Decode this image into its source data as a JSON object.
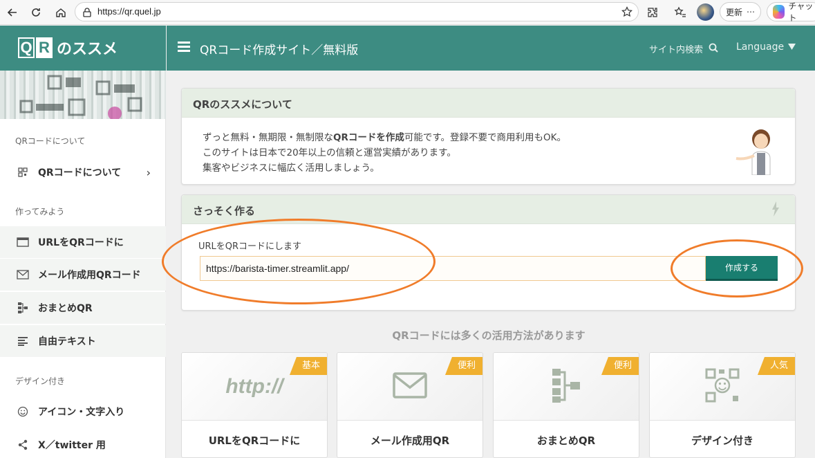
{
  "browser": {
    "url": "https://qr.quel.jp",
    "update_label": "更新",
    "more_label": "⋯",
    "chat_label": "チャット"
  },
  "header": {
    "logo_q": "Q",
    "logo_r": "R",
    "logo_suffix": "のススメ",
    "title": "QRコード作成サイト／無料版",
    "site_search": "サイト内検索",
    "language": "Language"
  },
  "sidebar": {
    "section_about": "QRコードについて",
    "item_about": "QRコードについて",
    "section_make": "作ってみよう",
    "items_make": [
      {
        "label": "URLをQRコードに"
      },
      {
        "label": "メール作成用QRコード"
      },
      {
        "label": "おまとめQR"
      },
      {
        "label": "自由テキスト"
      }
    ],
    "section_design": "デザイン付き",
    "items_design": [
      {
        "label": "アイコン・文字入り"
      },
      {
        "label": "X／twitter 用"
      }
    ]
  },
  "about_card": {
    "title": "QRのススメについて",
    "line1_pre": "ずっと無料・無期限・無制限な",
    "line1_bold": "QRコードを作成",
    "line1_post": "可能です。登録不要で商用利用もOK。",
    "line2": "このサイトは日本で20年以上の信頼と運営実績があります。",
    "line3": "集客やビジネスに幅広く活用しましょう。"
  },
  "quick_card": {
    "title": "さっそく作る",
    "field_label": "URLをQRコードにします",
    "url_value": "https://barista-timer.streamlit.app/",
    "create_label": "作成する"
  },
  "uses": {
    "heading": "QRコードには多くの活用方法があります",
    "tiles": [
      {
        "badge": "基本",
        "label": "URLをQRコードに",
        "art": "http://"
      },
      {
        "badge": "便利",
        "label": "メール作成用QR"
      },
      {
        "badge": "便利",
        "label": "おまとめQR"
      },
      {
        "badge": "人気",
        "label": "デザイン付き"
      }
    ]
  },
  "colors": {
    "brand": "#3d8c82",
    "button": "#197e70",
    "badge": "#f0b030",
    "annotation": "#f07c2a"
  }
}
